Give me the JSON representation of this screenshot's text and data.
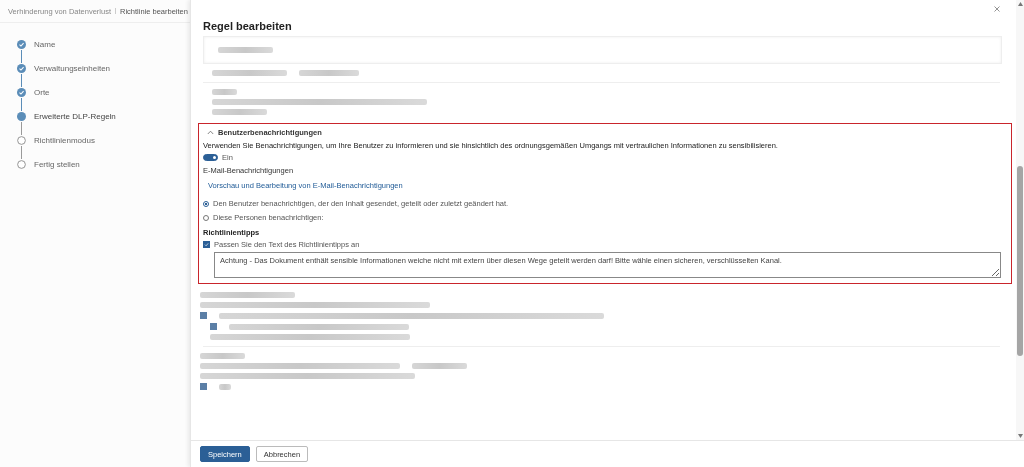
{
  "breadcrumb": [
    {
      "label": "Verhinderung von Datenverlust"
    },
    {
      "label": "Richtlinie bearbeiten"
    }
  ],
  "steps": [
    {
      "label": "Name",
      "kind": "done"
    },
    {
      "label": "Verwaltungseinheiten",
      "kind": "done"
    },
    {
      "label": "Orte",
      "kind": "done"
    },
    {
      "label": "Erweiterte DLP-Regeln",
      "kind": "current"
    },
    {
      "label": "Richtlinienmodus",
      "kind": "pending"
    },
    {
      "label": "Fertig stellen",
      "kind": "pending"
    }
  ],
  "panel": {
    "title": "Regel bearbeiten",
    "section": {
      "title": "Benutzerbenachrichtigungen",
      "expanded": true,
      "description": "Verwenden Sie Benachrichtigungen, um Ihre Benutzer zu informieren und sie hinsichtlich des ordnungsgemäßen Umgangs mit vertraulichen Informationen zu sensibilisieren.",
      "toggle": {
        "on": true,
        "label": "Ein"
      },
      "email_heading": "E-Mail-Benachrichtigungen",
      "email_link": "Vorschau und Bearbeitung von E-Mail-Benachrichtigungen",
      "options": [
        {
          "label": "Den Benutzer benachrichtigen, der den Inhalt gesendet, geteilt oder zuletzt geändert hat.",
          "selected": true
        },
        {
          "label": "Diese Personen benachrichtigen:",
          "selected": false
        }
      ],
      "tips_heading": "Richtlinientipps",
      "customize": {
        "label": "Passen Sie den Text des Richtlinientipps an",
        "checked": true
      },
      "tip_text": "Achtung - Das Dokument enthält sensible Informationen weiche nicht mit extern über diesen Wege geteilt werden darf! Bitte wähle einen sicheren, verschlüsselten Kanal."
    }
  },
  "buttons": [
    {
      "label": "Speichern",
      "kind": "primary"
    },
    {
      "label": "Abbrechen",
      "kind": "secondary"
    }
  ]
}
